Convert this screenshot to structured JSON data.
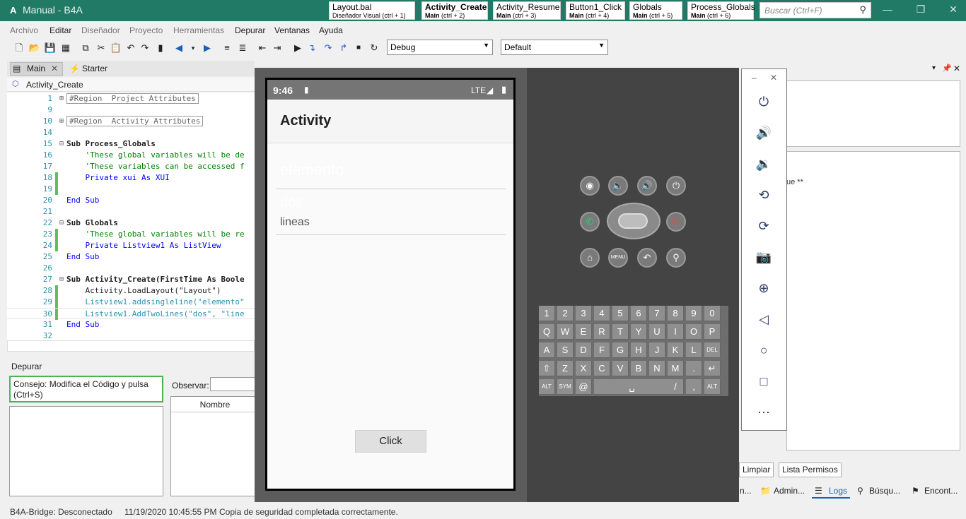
{
  "window": {
    "app_icon": "A",
    "title": "Manual - B4A"
  },
  "doc_tabs": [
    {
      "name": "Layout.bal",
      "sub": "Diseñador Visual",
      "shortcut": "(ctrl + 1)"
    },
    {
      "name": "Activity_Create",
      "sub": "Main",
      "shortcut": "(ctrl + 2)"
    },
    {
      "name": "Activity_Resume",
      "sub": "Main",
      "shortcut": "(ctrl + 3)"
    },
    {
      "name": "Button1_Click",
      "sub": "Main",
      "shortcut": "(ctrl + 4)"
    },
    {
      "name": "Globals",
      "sub": "Main",
      "shortcut": "(ctrl + 5)"
    },
    {
      "name": "Process_Globals",
      "sub": "Main",
      "shortcut": "(ctrl + 6)"
    }
  ],
  "search": {
    "placeholder": "Buscar (Ctrl+F)"
  },
  "menu": [
    "Archivo",
    "Editar",
    "Diseñador",
    "Proyecto",
    "Herramientas",
    "Depurar",
    "Ventanas",
    "Ayuda"
  ],
  "toolbar": {
    "build_config": "Debug",
    "target": "Default"
  },
  "editor": {
    "tabs": [
      "Main",
      "Starter"
    ],
    "current_sub": "Activity_Create",
    "lines": [
      {
        "n": "1",
        "t": "#Region  Project Attributes"
      },
      {
        "n": "9",
        "t": ""
      },
      {
        "n": "10",
        "t": "#Region  Activity Attributes"
      },
      {
        "n": "14",
        "t": ""
      },
      {
        "n": "15",
        "t": "Sub Process_Globals"
      },
      {
        "n": "16",
        "t": "    'These global variables will be de"
      },
      {
        "n": "17",
        "t": "    'These variables can be accessed f"
      },
      {
        "n": "18",
        "t": "    Private xui As XUI"
      },
      {
        "n": "19",
        "t": ""
      },
      {
        "n": "20",
        "t": "End Sub"
      },
      {
        "n": "21",
        "t": ""
      },
      {
        "n": "22",
        "t": "Sub Globals"
      },
      {
        "n": "23",
        "t": "    'These global variables will be re"
      },
      {
        "n": "24",
        "t": "    Private Listview1 As ListView"
      },
      {
        "n": "25",
        "t": "End Sub"
      },
      {
        "n": "26",
        "t": ""
      },
      {
        "n": "27",
        "t": "Sub Activity_Create(FirstTime As Boole"
      },
      {
        "n": "28",
        "t": "    Activity.LoadLayout(\"Layout\")"
      },
      {
        "n": "29",
        "t": "    Listview1.addsingleline(\"elemento\""
      },
      {
        "n": "30",
        "t": "    Listview1.AddTwoLines(\"dos\", \"line"
      },
      {
        "n": "31",
        "t": "End Sub"
      },
      {
        "n": "32",
        "t": ""
      }
    ]
  },
  "debug": {
    "header": "Depurar",
    "tip": "Consejo: Modifica el Código y pulsa (Ctrl+S)",
    "watch_label": "Observar:",
    "column_name": "Nombre"
  },
  "status": {
    "bridge": "B4A-Bridge: Desconectado",
    "datetime": "11/19/2020 10:45:55 PM",
    "message": "Copia de seguridad completada correctamente."
  },
  "phone": {
    "time": "9:46",
    "network": "LTE",
    "activity_title": "Activity",
    "list_item1": "elemento",
    "list_item2_line1": "dos",
    "list_item2_line2": "lineas",
    "button_label": "Click"
  },
  "keyboard": {
    "row1": [
      "1",
      "2",
      "3",
      "4",
      "5",
      "6",
      "7",
      "8",
      "9",
      "0"
    ],
    "row2": [
      "Q",
      "W",
      "E",
      "R",
      "T",
      "Y",
      "U",
      "I",
      "O",
      "P"
    ],
    "row3": [
      "A",
      "S",
      "D",
      "F",
      "G",
      "H",
      "J",
      "K",
      "L",
      "DEL"
    ],
    "row4": [
      "⇧",
      "Z",
      "X",
      "C",
      "V",
      "B",
      "N",
      "M",
      ".",
      "↵"
    ],
    "row5_alt": "ALT",
    "row5_sym": "SYM",
    "row5_at": "@",
    "row5_slash": "/",
    "row5_comma": ","
  },
  "right_panel": {
    "btn_clear": "Limpiar",
    "btn_permissions": "Lista Permisos",
    "partial_text": "ue **",
    "tabs": [
      "n...",
      "Admin...",
      "Logs",
      "Búsqu...",
      "Encont..."
    ]
  }
}
